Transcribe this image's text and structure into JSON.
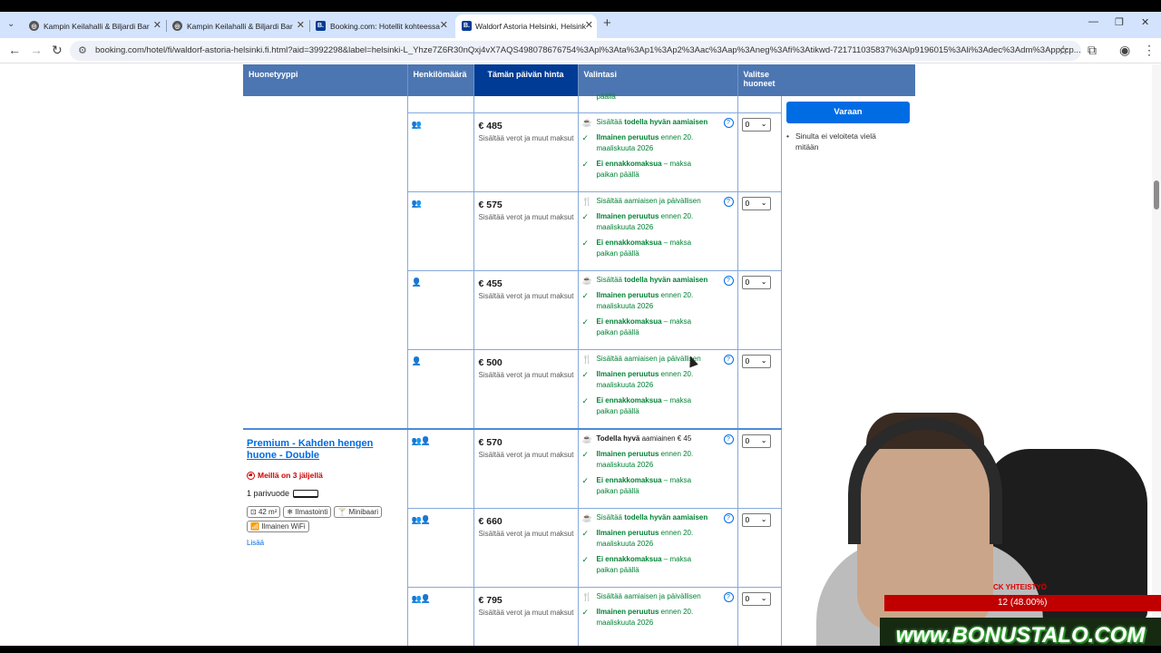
{
  "browser": {
    "tabs": [
      {
        "title": "Kampin Keilahalli & Biljardi Bar",
        "favicon": "globe-icon"
      },
      {
        "title": "Kampin Keilahalli & Biljardi Bar",
        "favicon": "globe-icon"
      },
      {
        "title": "Booking.com: Hotellit kohteessa",
        "favicon": "B."
      },
      {
        "title": "Waldorf Astoria Helsinki, Helsink",
        "favicon": "B."
      }
    ],
    "url": "booking.com/hotel/fi/waldorf-astoria-helsinki.fi.html?aid=3992298&label=helsinki-L_Yhze7Z6R30nQxj4vX7AQS498078676754%3Apl%3Ata%3Ap1%3Ap2%3Aac%3Aap%3Aneg%3Afi%3Atikwd-721711035837%3Alp9196015%3Ali%3Adec%3Adm%3Appccp..."
  },
  "table": {
    "headers": {
      "room_type": "Huonetyyppi",
      "persons": "Henkilömäärä",
      "price_today": "Tämän päivän hinta",
      "choices": "Valintasi",
      "select_rooms": "Valitse huoneet"
    },
    "partial_top": "päällä",
    "taxes": "Sisältää verot ja muut maksut",
    "rows": [
      {
        "persons": "👥",
        "price": "€ 485",
        "meal_icon": "☕",
        "meal_prefix": "Sisältää",
        "meal_bold": "todella hyvän aamiaisen",
        "meal_suffix": "",
        "cancel_bold": "Ilmainen peruutus",
        "cancel_rest": "ennen 20. maaliskuuta 2026",
        "prepay_bold": "Ei ennakkomaksua",
        "prepay_rest": "– maksa paikan päällä",
        "qty": "0"
      },
      {
        "persons": "👥",
        "price": "€ 575",
        "meal_icon": "🍴",
        "meal_prefix": "Sisältää aamiaisen ja päivällisen",
        "meal_bold": "",
        "meal_suffix": "",
        "cancel_bold": "Ilmainen peruutus",
        "cancel_rest": "ennen 20. maaliskuuta 2026",
        "prepay_bold": "Ei ennakkomaksua",
        "prepay_rest": "– maksa paikan päällä",
        "qty": "0"
      },
      {
        "persons": "👤",
        "price": "€ 455",
        "meal_icon": "☕",
        "meal_prefix": "Sisältää",
        "meal_bold": "todella hyvän aamiaisen",
        "meal_suffix": "",
        "cancel_bold": "Ilmainen peruutus",
        "cancel_rest": "ennen 20. maaliskuuta 2026",
        "prepay_bold": "Ei ennakkomaksua",
        "prepay_rest": "– maksa paikan päällä",
        "qty": "0"
      },
      {
        "persons": "👤",
        "price": "€ 500",
        "meal_icon": "🍴",
        "meal_prefix": "Sisältää aamiaisen ja päivällisen",
        "meal_bold": "",
        "meal_suffix": "",
        "cancel_bold": "Ilmainen peruutus",
        "cancel_rest": "ennen 20. maaliskuuta 2026",
        "prepay_bold": "Ei ennakkomaksua",
        "prepay_rest": "– maksa paikan päällä",
        "qty": "0"
      },
      {
        "persons": "👥👤",
        "price": "€ 570",
        "meal_icon": "☕",
        "meal_prefix": "",
        "meal_bold": "Todella hyvä",
        "meal_suffix": "aamiainen € 45",
        "cancel_bold": "Ilmainen peruutus",
        "cancel_rest": "ennen 20. maaliskuuta 2026",
        "prepay_bold": "Ei ennakkomaksua",
        "prepay_rest": "– maksa paikan päällä",
        "qty": "0"
      },
      {
        "persons": "👥👤",
        "price": "€ 660",
        "meal_icon": "☕",
        "meal_prefix": "Sisältää",
        "meal_bold": "todella hyvän aamiaisen",
        "meal_suffix": "",
        "cancel_bold": "Ilmainen peruutus",
        "cancel_rest": "ennen 20. maaliskuuta 2026",
        "prepay_bold": "Ei ennakkomaksua",
        "prepay_rest": "– maksa paikan päällä",
        "qty": "0"
      },
      {
        "persons": "👥👤",
        "price": "€ 795",
        "meal_icon": "🍴",
        "meal_prefix": "Sisältää aamiaisen ja päivällisen",
        "meal_bold": "",
        "meal_suffix": "",
        "cancel_bold": "Ilmainen peruutus",
        "cancel_rest": "ennen 20. maaliskuuta 2026",
        "prepay_bold": "",
        "prepay_rest": "",
        "qty": "0"
      }
    ],
    "premium_room": {
      "name": "Premium - Kahden hengen huone - Double",
      "scarcity": "Meillä on 3 jäljellä",
      "bed": "1 parivuode",
      "facilities": [
        "42 m²",
        "Ilmastointi",
        "Minibaari",
        "Ilmainen WiFi"
      ],
      "more": "Lisää"
    }
  },
  "sidebar": {
    "reserve": "Varaan",
    "note": "Sinulta ei veloiteta vielä mitään"
  },
  "overlay": {
    "promo_top": "CK YHTEISTYÖ",
    "promo_value": "12 (48.00%)",
    "brand": "www.BONUSTALO.COM",
    "brand_color": "#2e8b2e"
  }
}
